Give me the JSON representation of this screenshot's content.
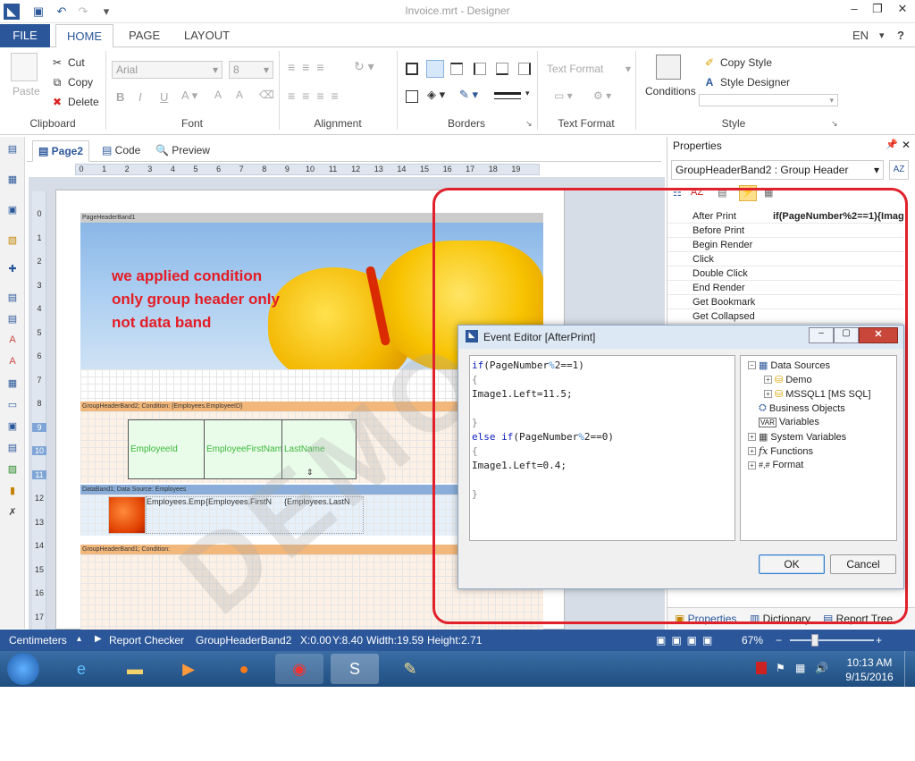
{
  "app": {
    "title": "Invoice.mrt - Designer"
  },
  "menu": {
    "file": "FILE",
    "tabs": [
      "HOME",
      "PAGE",
      "LAYOUT"
    ],
    "language": "EN"
  },
  "clipboard": {
    "paste": "Paste",
    "cut": "Cut",
    "copy": "Copy",
    "delete": "Delete",
    "label": "Clipboard"
  },
  "font": {
    "family": "Arial",
    "size": "8",
    "label": "Font"
  },
  "alignment": {
    "label": "Alignment"
  },
  "borders": {
    "label": "Borders"
  },
  "text_format": {
    "combo": "Text Format",
    "label": "Text Format"
  },
  "style": {
    "conditions": "Conditions",
    "copy_style": "Copy Style",
    "style_designer": "Style Designer",
    "label": "Style"
  },
  "doc_tabs": [
    "Page2",
    "Code",
    "Preview"
  ],
  "ruler": {
    "h": [
      "0",
      "1",
      "2",
      "3",
      "4",
      "5",
      "6",
      "7",
      "8",
      "9",
      "10",
      "11",
      "12",
      "13",
      "14",
      "15",
      "16",
      "17",
      "18",
      "19"
    ],
    "v": [
      "0",
      "1",
      "2",
      "3",
      "4",
      "5",
      "6",
      "7",
      "8",
      "9",
      "10",
      "11",
      "12",
      "13",
      "14",
      "15",
      "16",
      "17"
    ]
  },
  "bands": {
    "page_header": "PageHeaderBand1",
    "group_header2": "GroupHeaderBand2; Condition: {Employees.EmployeeID}",
    "data": "DataBand1; Data Source: Employees",
    "group_header1": "GroupHeaderBand1; Condition:"
  },
  "cells": {
    "header": [
      "EmployeeId",
      "EmployeeFirstName",
      "LastName"
    ],
    "data": [
      "Employees.Emplo",
      "{Employees.FirstN",
      "{Employees.LastN"
    ]
  },
  "annotation": [
    "we applied condition",
    "only group header only",
    "not data band"
  ],
  "watermark": "DEMO",
  "properties": {
    "title": "Properties",
    "selector": "GroupHeaderBand2 : Group Header",
    "events": [
      {
        "name": "After Print",
        "value": "if(PageNumber%2==1){Image"
      },
      {
        "name": "Before Print",
        "value": ""
      },
      {
        "name": "Begin Render",
        "value": ""
      },
      {
        "name": "Click",
        "value": ""
      },
      {
        "name": "Double Click",
        "value": ""
      },
      {
        "name": "End Render",
        "value": ""
      },
      {
        "name": "Get Bookmark",
        "value": ""
      },
      {
        "name": "Get Collapsed",
        "value": ""
      }
    ],
    "bottom_tabs": [
      "Properties",
      "Dictionary",
      "Report Tree"
    ]
  },
  "dialog": {
    "title": "Event Editor [AfterPrint]",
    "ok": "OK",
    "cancel": "Cancel",
    "tree": [
      "Data Sources",
      "Demo",
      "MSSQL1 [MS SQL]",
      "Business Objects",
      "Variables",
      "System Variables",
      "Functions",
      "Format"
    ]
  },
  "status": {
    "units": "Centimeters",
    "checker": "Report Checker",
    "component": "GroupHeaderBand2",
    "x": "X:0.00",
    "y": "Y:8.40",
    "width": "Width:19.59",
    "height": "Height:2.71",
    "zoom": "67%"
  },
  "taskbar": {
    "time": "10:13 AM",
    "date": "9/15/2016"
  }
}
